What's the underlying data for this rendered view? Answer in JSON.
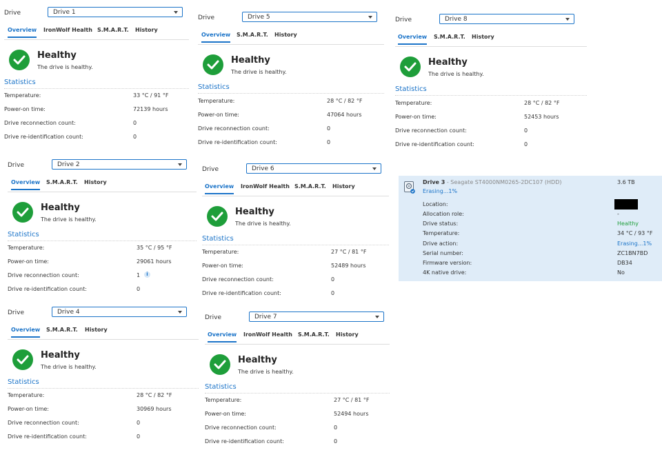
{
  "common": {
    "drive_label": "Drive",
    "health_title": "Healthy",
    "health_desc": "The drive is healthy.",
    "stats_title": "Statistics",
    "labels": {
      "temperature": "Temperature:",
      "power_on": "Power-on time:",
      "reconnection": "Drive reconnection count:",
      "reid": "Drive re-identification count:"
    },
    "tabs": {
      "overview": "Overview",
      "ironwolf": "IronWolf Health",
      "smart": "S.M.A.R.T.",
      "history": "History"
    }
  },
  "panels": [
    {
      "drive": "Drive 1",
      "ironwolf": true,
      "temperature": "33 °C / 91 °F",
      "power_on": "72139 hours",
      "reconnection": "0",
      "reid": "0"
    },
    {
      "drive": "Drive 2",
      "ironwolf": false,
      "temperature": "35 °C / 95 °F",
      "power_on": "29061 hours",
      "reconnection": "1",
      "reid": "0"
    },
    {
      "drive": "Drive 4",
      "ironwolf": false,
      "temperature": "28 °C / 82 °F",
      "power_on": "30969 hours",
      "reconnection": "0",
      "reid": "0"
    },
    {
      "drive": "Drive 5",
      "ironwolf": false,
      "temperature": "28 °C / 82 °F",
      "power_on": "47064 hours",
      "reconnection": "0",
      "reid": "0"
    },
    {
      "drive": "Drive 6",
      "ironwolf": true,
      "temperature": "27 °C / 81 °F",
      "power_on": "52489 hours",
      "reconnection": "0",
      "reid": "0"
    },
    {
      "drive": "Drive 7",
      "ironwolf": true,
      "temperature": "27 °C / 81 °F",
      "power_on": "52494 hours",
      "reconnection": "0",
      "reid": "0"
    },
    {
      "drive": "Drive 8",
      "ironwolf": false,
      "temperature": "28 °C / 82 °F",
      "power_on": "52453 hours",
      "reconnection": "0",
      "reid": "0"
    }
  ],
  "drive3": {
    "name": "Drive 3",
    "model": " - Seagate ST4000NM0265-2DC107 (HDD)",
    "size": "3.6 TB",
    "status_line": "Erasing...1%",
    "rows": [
      {
        "k": "Location:",
        "v": ""
      },
      {
        "k": "Allocation role:",
        "v": "-"
      },
      {
        "k": "Drive status:",
        "v": "Healthy"
      },
      {
        "k": "Temperature:",
        "v": "34 °C / 93 °F"
      },
      {
        "k": "Drive action:",
        "v": "Erasing...1%"
      },
      {
        "k": "Serial number:",
        "v": "ZC1BN7BD"
      },
      {
        "k": "Firmware version:",
        "v": "DB34"
      },
      {
        "k": "4K native drive:",
        "v": "No"
      }
    ]
  },
  "colors": {
    "accent": "#1a73c8",
    "healthy": "#1e9e3a",
    "card_bg": "#dfecf8"
  }
}
